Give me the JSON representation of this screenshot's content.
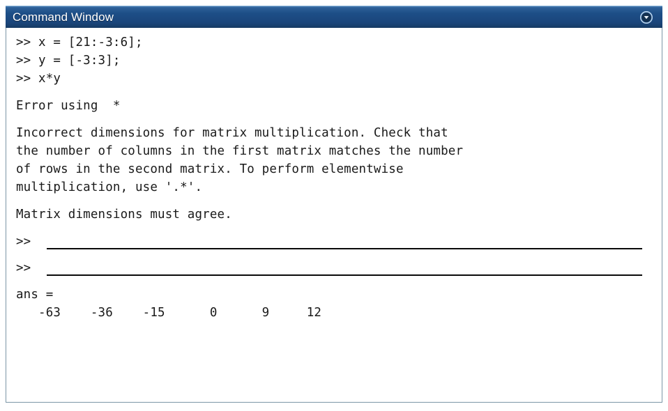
{
  "window": {
    "title": "Command Window",
    "titlebar_color": "#1d4e87",
    "titlebar_text_color": "#ffffff",
    "border_color": "#7c96a6",
    "background_color": "#ffffff",
    "text_color": "#1a1a1a"
  },
  "titlebar": {
    "dropdown_icon": "circle-chevron-down-icon"
  },
  "console": {
    "prompt_symbol": ">>",
    "commands": [
      ">> x = [21:-3:6];",
      ">> y = [-3:3];",
      ">> x*y"
    ],
    "error_header": "Error using  *",
    "error_body": [
      "Incorrect dimensions for matrix multiplication. Check that",
      "the number of columns in the first matrix matches the number",
      "of rows in the second matrix. To perform elementwise",
      "multiplication, use '.*'."
    ],
    "error_footer": "Matrix dimensions must agree.",
    "annotated_prompts": [
      ">>",
      ">>"
    ],
    "result_label": "ans =",
    "result_row": "   -63    -36    -15      0      9     12"
  },
  "result_values": [
    -63,
    -36,
    -15,
    0,
    9,
    12
  ]
}
